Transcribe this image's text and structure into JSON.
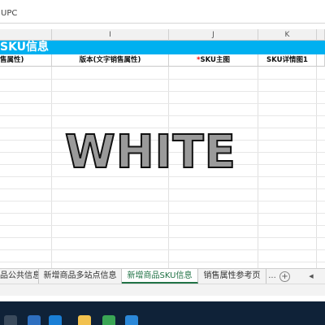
{
  "formula_bar": {
    "content": "UPC"
  },
  "columns": [
    {
      "id": "h",
      "label": ""
    },
    {
      "id": "i",
      "label": "I"
    },
    {
      "id": "j",
      "label": "J"
    },
    {
      "id": "k",
      "label": "K"
    }
  ],
  "section_title": "SKU信息",
  "headers": [
    {
      "text": "售属性)",
      "required": false
    },
    {
      "text": "版本(文字销售属性)",
      "required": false
    },
    {
      "text": "SKU主图",
      "required": true
    },
    {
      "text": "SKU详情图1",
      "required": false
    }
  ],
  "required_marker": "*",
  "watermark": "WHITE",
  "tabs": [
    {
      "label": "品公共信息",
      "active": false
    },
    {
      "label": "新增商品多站点信息",
      "active": false
    },
    {
      "label": "新增商品SKU信息",
      "active": true
    },
    {
      "label": "销售属性参考页",
      "active": false
    }
  ],
  "tab_controls": {
    "more": "...",
    "add": "+",
    "prev": "◀"
  },
  "colors": {
    "title_bg": "#00b0f0",
    "active_tab": "#217346",
    "required": "#ff0000"
  }
}
